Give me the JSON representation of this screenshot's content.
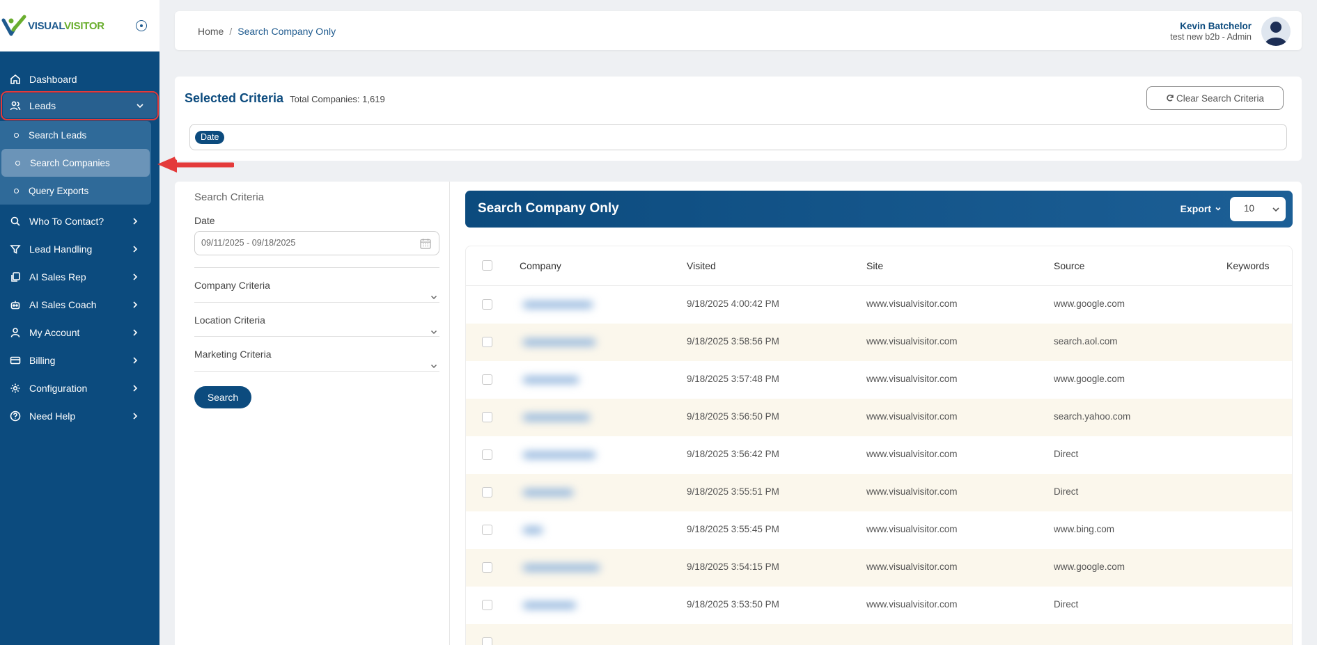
{
  "logo": {
    "part1": "VISUAL",
    "part2": "VISITOR"
  },
  "sidebar": {
    "items": [
      {
        "label": "Dashboard"
      },
      {
        "label": "Leads"
      },
      {
        "label": "Who To Contact?"
      },
      {
        "label": "Lead Handling"
      },
      {
        "label": "AI Sales Rep"
      },
      {
        "label": "AI Sales Coach"
      },
      {
        "label": "My Account"
      },
      {
        "label": "Billing"
      },
      {
        "label": "Configuration"
      },
      {
        "label": "Need Help"
      }
    ],
    "leads_sub": [
      {
        "label": "Search Leads"
      },
      {
        "label": "Search Companies"
      },
      {
        "label": "Query Exports"
      }
    ]
  },
  "breadcrumb": {
    "home": "Home",
    "separator": "/",
    "current": "Search Company Only"
  },
  "user": {
    "name": "Kevin Batchelor",
    "role": "test new b2b - Admin"
  },
  "criteria": {
    "title": "Selected Criteria",
    "total": "Total Companies: 1,619",
    "clear_label": "Clear Search Criteria",
    "chips": [
      "Date"
    ]
  },
  "filters": {
    "title": "Search Criteria",
    "date_label": "Date",
    "date_value": "09/11/2025 - 09/18/2025",
    "sections": [
      "Company Criteria",
      "Location Criteria",
      "Marketing Criteria"
    ],
    "search_label": "Search"
  },
  "results": {
    "title": "Search Company Only",
    "export_label": "Export",
    "page_size": "10",
    "columns": [
      "Company",
      "Visited",
      "Site",
      "Source",
      "Keywords"
    ],
    "rows": [
      {
        "visited": "9/18/2025 4:00:42 PM",
        "site": "www.visualvisitor.com",
        "source": "www.google.com",
        "keywords": ""
      },
      {
        "visited": "9/18/2025 3:58:56 PM",
        "site": "www.visualvisitor.com",
        "source": "search.aol.com",
        "keywords": ""
      },
      {
        "visited": "9/18/2025 3:57:48 PM",
        "site": "www.visualvisitor.com",
        "source": "www.google.com",
        "keywords": ""
      },
      {
        "visited": "9/18/2025 3:56:50 PM",
        "site": "www.visualvisitor.com",
        "source": "search.yahoo.com",
        "keywords": ""
      },
      {
        "visited": "9/18/2025 3:56:42 PM",
        "site": "www.visualvisitor.com",
        "source": "Direct",
        "keywords": ""
      },
      {
        "visited": "9/18/2025 3:55:51 PM",
        "site": "www.visualvisitor.com",
        "source": "Direct",
        "keywords": ""
      },
      {
        "visited": "9/18/2025 3:55:45 PM",
        "site": "www.visualvisitor.com",
        "source": "www.bing.com",
        "keywords": ""
      },
      {
        "visited": "9/18/2025 3:54:15 PM",
        "site": "www.visualvisitor.com",
        "source": "www.google.com",
        "keywords": ""
      },
      {
        "visited": "9/18/2025 3:53:50 PM",
        "site": "www.visualvisitor.com",
        "source": "Direct",
        "keywords": ""
      }
    ]
  },
  "colors": {
    "primary": "#0c4b7e",
    "accent_green": "#6aae2e",
    "highlight": "#e43a3a",
    "row_alt": "#fbf7ec"
  }
}
